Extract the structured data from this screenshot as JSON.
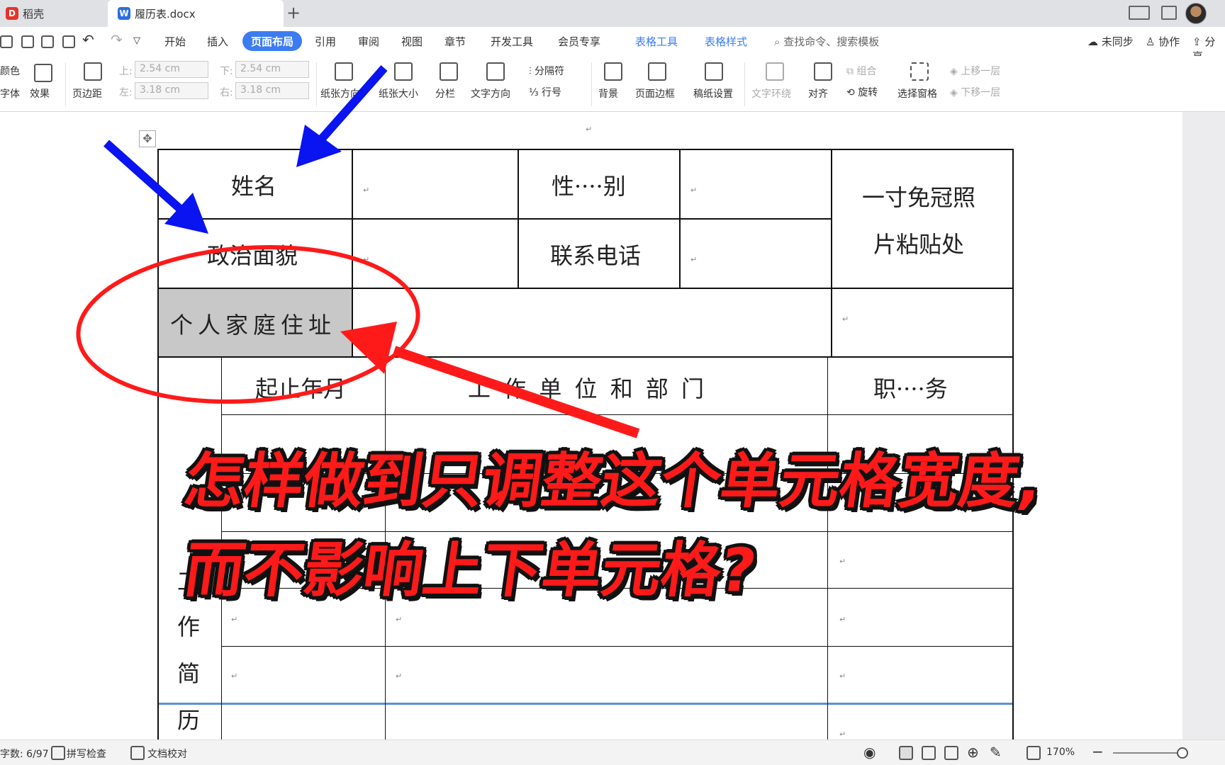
{
  "tabs": [
    {
      "label": "稻壳"
    },
    {
      "label": "履历表.docx"
    }
  ],
  "menu": [
    "开始",
    "插入",
    "页面布局",
    "引用",
    "审阅",
    "视图",
    "章节",
    "开发工具",
    "会员专享",
    "表格工具",
    "表格样式"
  ],
  "search": {
    "placeholder": "查找命令、搜索模板"
  },
  "right_menu": [
    "未同步",
    "协作",
    "分享"
  ],
  "ribbon": {
    "color": "颜色",
    "font": "字体",
    "effect": "效果",
    "margins": "页边距",
    "top_label": "上:",
    "top_value": "2.54 cm",
    "bottom_label": "下:",
    "bottom_value": "2.54 cm",
    "left_label": "左:",
    "left_value": "3.18 cm",
    "right_label": "右:",
    "right_value": "3.18 cm",
    "orientation": "纸张方向",
    "size": "纸张大小",
    "columns": "分栏",
    "text_direction": "文字方向",
    "separator": "分隔符",
    "line_number": "行号",
    "background": "背景",
    "page_border": "页面边框",
    "manuscript": "稿纸设置",
    "wrap": "文字环绕",
    "align": "对齐",
    "group": "组合",
    "rotate": "旋转",
    "selection_pane": "选择窗格",
    "bring_forward": "上移一层",
    "send_backward": "下移一层"
  },
  "table": {
    "name": "姓名",
    "gender": "性····别",
    "photo_line1": "一寸免冠照",
    "photo_line2": "片粘贴处",
    "political": "政治面貌",
    "phone": "联系电话",
    "address": "个人家庭住址",
    "period": "起止年月",
    "employer": "工 作 单 位 和 部 门",
    "position": "职····务",
    "resume_v": [
      "工",
      "作",
      "简",
      "历"
    ]
  },
  "annotation": {
    "line1": "怎样做到只调整这个单元格宽度,",
    "line2": "而不影响上下单元格?"
  },
  "status": {
    "word_count": "字数: 6/97",
    "spell_check": "拼写检查",
    "doc_proof": "文档校对",
    "zoom": "170%"
  },
  "colors": {
    "accent": "#3c7cf3",
    "annotation_red": "#ff1a1a",
    "arrow_blue": "#0a14f0"
  }
}
